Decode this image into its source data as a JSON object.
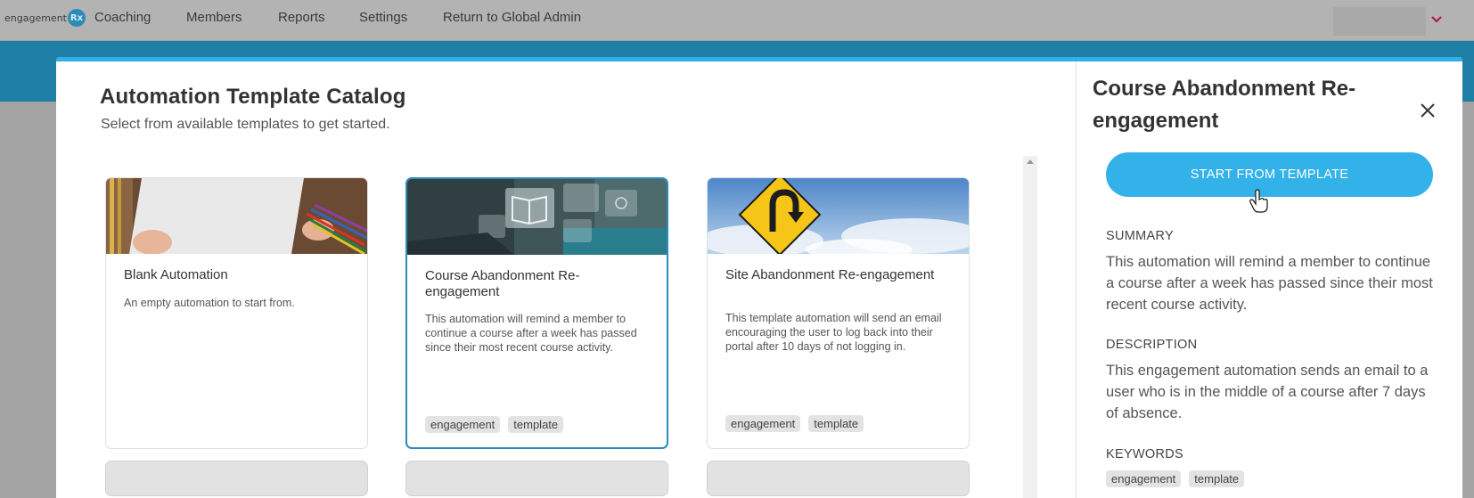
{
  "nav": {
    "logo_text": "engagement",
    "logo_badge": "Rx",
    "links": [
      "Coaching",
      "Members",
      "Reports",
      "Settings",
      "Return to Global Admin"
    ]
  },
  "catalog": {
    "title": "Automation Template Catalog",
    "subtitle": "Select from available templates to get started."
  },
  "cards": [
    {
      "title": "Blank Automation",
      "description": "An empty automation to start from.",
      "tags": []
    },
    {
      "title": "Course Abandonment Re-engagement",
      "description": "This automation will remind a member to continue a course after a week has passed since their most recent course activity.",
      "tags": [
        "engagement",
        "template"
      ]
    },
    {
      "title": "Site Abandonment Re-engagement",
      "description": "This template automation will send an email encouraging the user to log back into their portal after 10 days of not logging in.",
      "tags": [
        "engagement",
        "template"
      ]
    }
  ],
  "detail": {
    "title": "Course Abandonment Re-engagement",
    "start_button": "START FROM TEMPLATE",
    "summary_label": "SUMMARY",
    "summary": "This automation will remind a member to continue a course after a week has passed since their most recent course activity.",
    "description_label": "DESCRIPTION",
    "description": "This engagement automation sends an email to a user who is in the middle of a course after 7 days of absence.",
    "keywords_label": "KEYWORDS",
    "keywords": [
      "engagement",
      "template"
    ]
  },
  "colors": {
    "accent": "#32b2e8",
    "selected_border": "#2d8bb8",
    "header_band": "#1f7fa7"
  }
}
